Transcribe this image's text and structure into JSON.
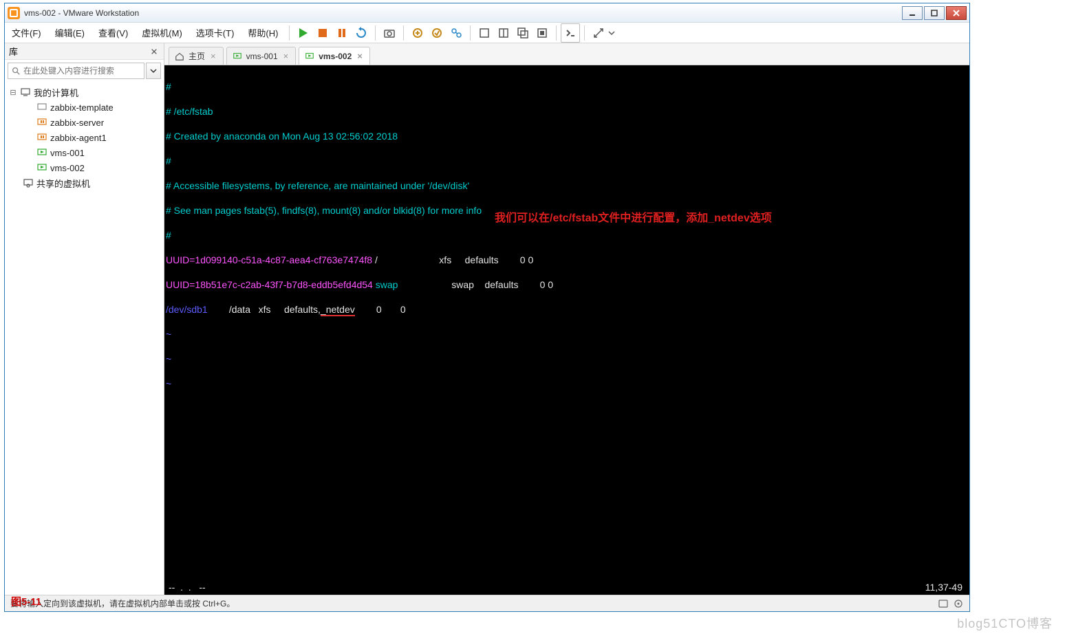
{
  "titlebar": {
    "text": "vms-002 - VMware Workstation"
  },
  "menus": [
    "文件(F)",
    "编辑(E)",
    "查看(V)",
    "虚拟机(M)",
    "选项卡(T)",
    "帮助(H)"
  ],
  "sidebar": {
    "title": "库",
    "search_placeholder": "在此处键入内容进行搜索",
    "root": "我的计算机",
    "items": [
      "zabbix-template",
      "zabbix-server",
      "zabbix-agent1",
      "vms-001",
      "vms-002"
    ],
    "shared": "共享的虚拟机"
  },
  "tabs": [
    {
      "label": "主页",
      "kind": "home",
      "active": false
    },
    {
      "label": "vms-001",
      "kind": "vm",
      "active": false
    },
    {
      "label": "vms-002",
      "kind": "vm",
      "active": true
    }
  ],
  "console": {
    "lines": [
      {
        "t": "#",
        "cls": "c-cyan"
      },
      {
        "t": "# /etc/fstab",
        "cls": "c-cyan"
      },
      {
        "t": "# Created by anaconda on Mon Aug 13 02:56:02 2018",
        "cls": "c-cyan"
      },
      {
        "t": "#",
        "cls": "c-cyan"
      },
      {
        "t": "# Accessible filesystems, by reference, are maintained under '/dev/disk'",
        "cls": "c-cyan"
      },
      {
        "t": "# See man pages fstab(5), findfs(8), mount(8) and/or blkid(8) for more info",
        "cls": "c-cyan"
      },
      {
        "t": "#",
        "cls": "c-cyan"
      }
    ],
    "uuid1_pre": "UUID=",
    "uuid1": "1d099140-c51a-4c87-aea4-cf763e7474f8",
    "uuid1_rest": " /                       xfs     defaults        0 0",
    "uuid2_pre": "UUID=",
    "uuid2": "18b51e7c-c2ab-43f7-b7d8-eddb5efd4d54",
    "uuid2_swap": " swap",
    "uuid2_rest": "                    swap    defaults        0 0",
    "dev_pre": "/dev/sdb1",
    "dev_mid": "        /data   xfs     defaults,",
    "dev_netdev": "_netdev",
    "dev_tail": "        0       0",
    "annotation": "我们可以在/etc/fstab文件中进行配置，添加_netdev选项",
    "foot_left": "--  .  .   -- ",
    "foot_right": "11,37-49"
  },
  "figure_label": "图5-11",
  "statusbar": {
    "text": "要将输入定向到该虚拟机，请在虚拟机内部单击或按 Ctrl+G。"
  },
  "watermark": "blog51CTO博客"
}
